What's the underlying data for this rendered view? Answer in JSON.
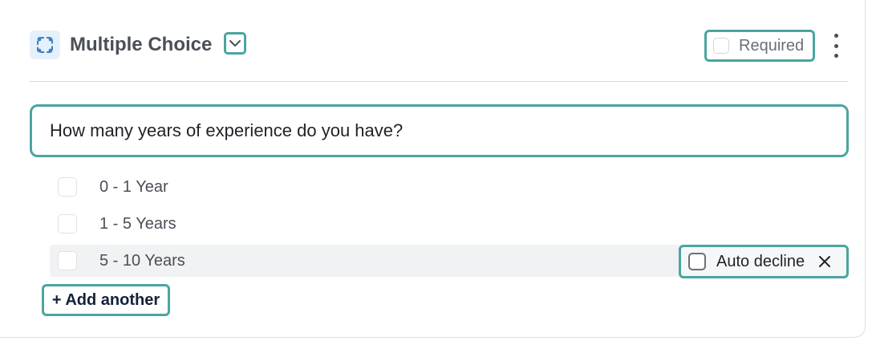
{
  "header": {
    "title": "Multiple Choice",
    "required_label": "Required",
    "type_icon": "multiple-choice-icon",
    "toggle_icon": "chevron-down-icon",
    "menu_icon": "kebab-menu-icon"
  },
  "question": {
    "text": "How many years of experience do you have?"
  },
  "options": [
    {
      "label": "0 - 1 Year"
    },
    {
      "label": "1 - 5 Years"
    },
    {
      "label": "5 - 10 Years"
    }
  ],
  "auto_decline": {
    "label": "Auto decline",
    "close_icon": "close-icon"
  },
  "add_another_label": "+ Add another",
  "colors": {
    "accent": "#4aa5a0",
    "title_text": "#4a4f57",
    "icon_bg": "#e6f0fa",
    "icon_blue": "#3b82c4",
    "highlight_row": "#f1f2f4"
  }
}
